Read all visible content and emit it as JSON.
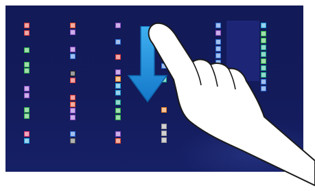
{
  "start_screen": {
    "background": "#141c5e",
    "tile_colors": [
      "#d63a3a",
      "#e0492d",
      "#2fb04a",
      "#8d4fc7",
      "#2f6fd6",
      "#16a38a",
      "#e67e22",
      "#9a9a9a",
      "#d9376e",
      "#1f9ad6"
    ],
    "app_tiles_icon": "app-tile-icon"
  },
  "gesture": {
    "type": "swipe-down",
    "arrow_icon": "down-arrow-icon",
    "arrow_color": "#1f8fe0",
    "hand_icon": "pointing-hand-icon"
  }
}
